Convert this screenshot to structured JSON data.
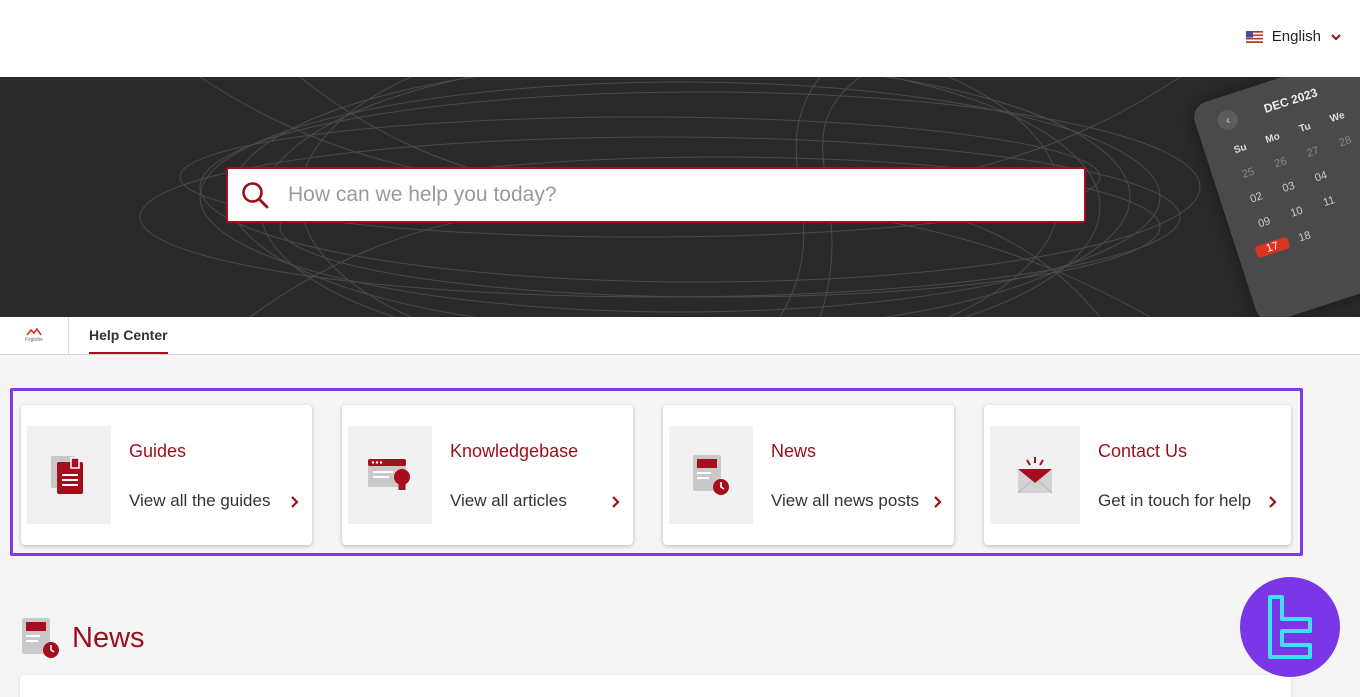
{
  "header": {
    "language": {
      "label": "English",
      "flag_icon": "us-flag-icon",
      "dropdown_icon": "chevron-down-icon"
    }
  },
  "hero": {
    "search": {
      "placeholder": "How can we help you today?",
      "icon": "search-icon",
      "value": ""
    },
    "calendar": {
      "month_label": "DEC 2023",
      "day_headers": [
        "Su",
        "Mo",
        "Tu",
        "We"
      ],
      "dates": [
        "25",
        "26",
        "27",
        "28",
        "02",
        "03",
        "04",
        "09",
        "10",
        "11",
        "17",
        "18"
      ]
    }
  },
  "tabbar": {
    "brand_text": "Fxglobe",
    "active_tab": "Help Center"
  },
  "cards": [
    {
      "title": "Guides",
      "link": "View all the guides",
      "icon": "guides-document-icon"
    },
    {
      "title": "Knowledgebase",
      "link": "View all articles",
      "icon": "knowledgebase-lightbulb-icon"
    },
    {
      "title": "News",
      "link": "View all news posts",
      "icon": "news-clock-icon"
    },
    {
      "title": "Contact Us",
      "link": "Get in touch for help",
      "icon": "envelope-icon"
    }
  ],
  "news_section": {
    "title": "News",
    "icon": "news-clock-icon"
  },
  "colors": {
    "brand_red": "#9d0e1b",
    "highlight_frame": "#7f3af0",
    "hero_bg": "#2a2a2a",
    "badge_purple": "#7b36e8",
    "badge_cyan": "#3fe0f0"
  }
}
